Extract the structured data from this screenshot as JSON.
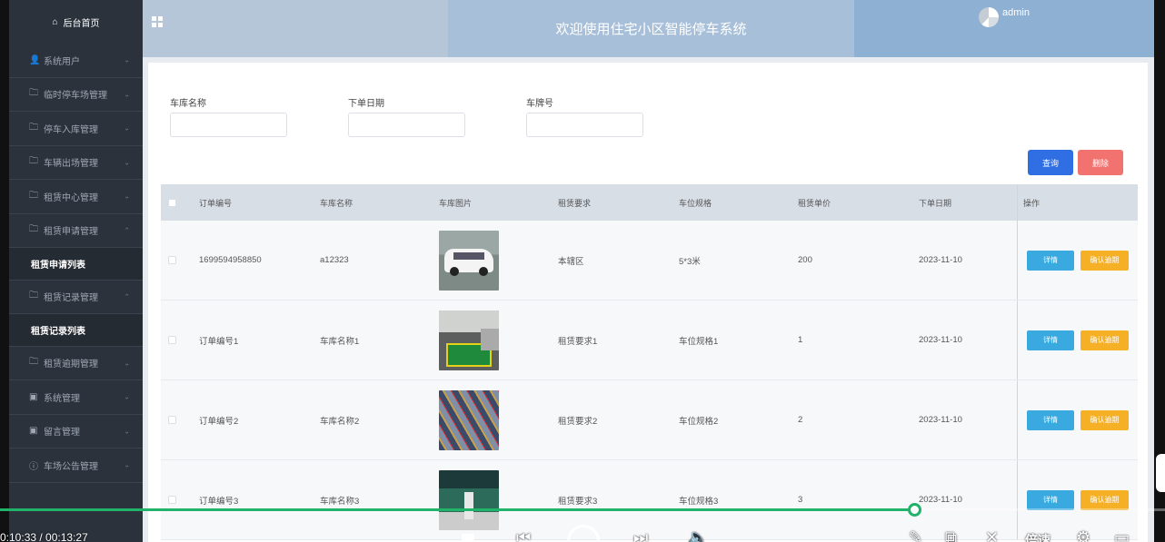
{
  "sidebar": {
    "home": "后台首页",
    "items": [
      {
        "label": "系统用户",
        "icon": "user-icon",
        "chev": "⌄"
      },
      {
        "label": "临时停车场管理",
        "icon": "folder-icon",
        "chev": "⌄"
      },
      {
        "label": "停车入库管理",
        "icon": "folder-icon",
        "chev": "⌄"
      },
      {
        "label": "车辆出场管理",
        "icon": "folder-icon",
        "chev": "⌄"
      },
      {
        "label": "租赁中心管理",
        "icon": "folder-icon",
        "chev": "⌄"
      },
      {
        "label": "租赁申请管理",
        "icon": "folder-icon",
        "chev": "⌃"
      },
      {
        "label": "租赁申请列表",
        "sub": true
      },
      {
        "label": "租赁记录管理",
        "icon": "folder-icon",
        "chev": "⌃"
      },
      {
        "label": "租赁记录列表",
        "sub": true
      },
      {
        "label": "租赁逾期管理",
        "icon": "folder-icon",
        "chev": "⌄"
      },
      {
        "label": "系统管理",
        "icon": "image-icon",
        "chev": "⌄"
      },
      {
        "label": "留言管理",
        "icon": "image-icon",
        "chev": "⌄"
      },
      {
        "label": "车场公告管理",
        "icon": "info-icon",
        "chev": "⌄"
      }
    ]
  },
  "header": {
    "title": "欢迎使用住宅小区智能停车系统",
    "user": "admin"
  },
  "search": {
    "garage_name_label": "车库名称",
    "order_date_label": "下单日期",
    "plate_label": "车牌号",
    "query_button": "查询",
    "delete_button": "删除"
  },
  "table": {
    "headers": [
      "订单编号",
      "车库名称",
      "车库图片",
      "租赁要求",
      "车位规格",
      "租赁单价",
      "下单日期",
      "操作"
    ],
    "rows": [
      {
        "order_no": "1699594958850",
        "garage": "a12323",
        "requirement": "本辖区",
        "spec": "5*3米",
        "price": "200",
        "date": "2023-11-10",
        "img": "car"
      },
      {
        "order_no": "订单编号1",
        "garage": "车库名称1",
        "requirement": "租赁要求1",
        "spec": "车位规格1",
        "price": "1",
        "date": "2023-11-10",
        "img": "garage"
      },
      {
        "order_no": "订单编号2",
        "garage": "车库名称2",
        "requirement": "租赁要求2",
        "spec": "车位规格2",
        "price": "2",
        "date": "2023-11-10",
        "img": "aerial"
      },
      {
        "order_no": "订单编号3",
        "garage": "车库名称3",
        "requirement": "租赁要求3",
        "spec": "车位规格3",
        "price": "3",
        "date": "2023-11-10",
        "img": "underground"
      }
    ],
    "detail_button": "详情",
    "confirm_button": "确认逾期"
  },
  "video": {
    "time": "0:10:33 / 00:13:27",
    "progress_fraction": 0.785,
    "speed_label": "倍速"
  }
}
